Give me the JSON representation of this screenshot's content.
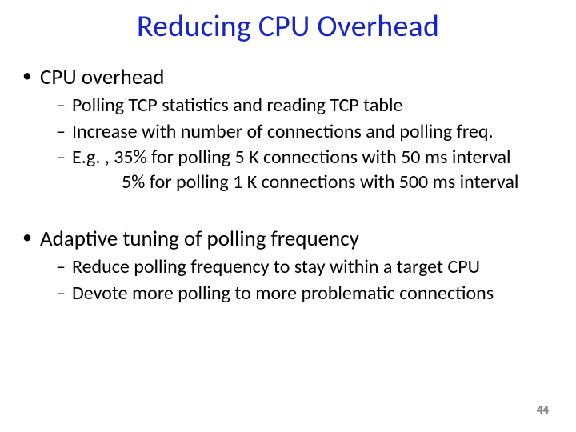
{
  "title": "Reducing CPU Overhead",
  "bullets": {
    "b1": {
      "heading": "CPU overhead",
      "s1": "Polling TCP statistics and reading TCP table",
      "s2": "Increase with number of connections and polling freq.",
      "s3": "E.g. , 35% for polling 5 K connections with 50 ms interval",
      "s3b": "5% for polling 1 K connections with 500 ms interval"
    },
    "b2": {
      "heading": "Adaptive tuning of polling frequency",
      "s1": "Reduce polling frequency to stay within a target CPU",
      "s2": "Devote more polling to more problematic connections"
    }
  },
  "page_number": "44"
}
